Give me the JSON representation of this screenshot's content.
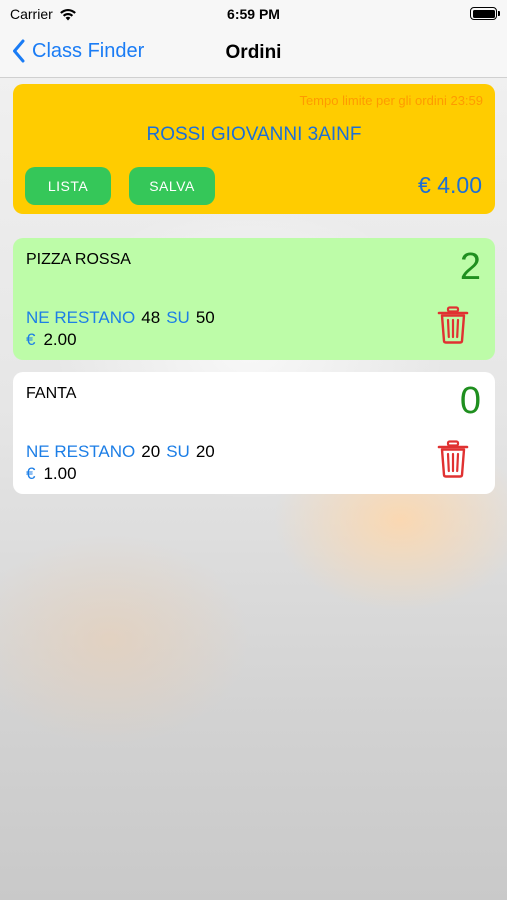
{
  "status": {
    "carrier": "Carrier",
    "time": "6:59 PM"
  },
  "nav": {
    "back_label": "Class Finder",
    "title": "Ordini"
  },
  "header": {
    "deadline": "Tempo limite per gli ordini 23:59",
    "student": "ROSSI GIOVANNI 3AINF",
    "list_button": "LISTA",
    "save_button": "SALVA",
    "total": "€ 4.00"
  },
  "labels": {
    "remaining": "NE RESTANO",
    "of": "SU",
    "currency": "€"
  },
  "items": [
    {
      "name": "PIZZA ROSSA",
      "quantity": "2",
      "remaining": "48",
      "total": "50",
      "price": "2.00"
    },
    {
      "name": "FANTA",
      "quantity": "0",
      "remaining": "20",
      "total": "20",
      "price": "1.00"
    }
  ],
  "colors": {
    "header_bg": "#ffcc00",
    "button_green": "#35c759",
    "accent_blue": "#1c6fd6",
    "selected_item_bg": "#bdfca8",
    "trash_red": "#e03131",
    "quantity_green": "#1f8f1f"
  },
  "icons": {
    "back": "chevron-left-icon",
    "wifi": "wifi-icon",
    "battery": "battery-icon",
    "delete": "trash-icon"
  }
}
